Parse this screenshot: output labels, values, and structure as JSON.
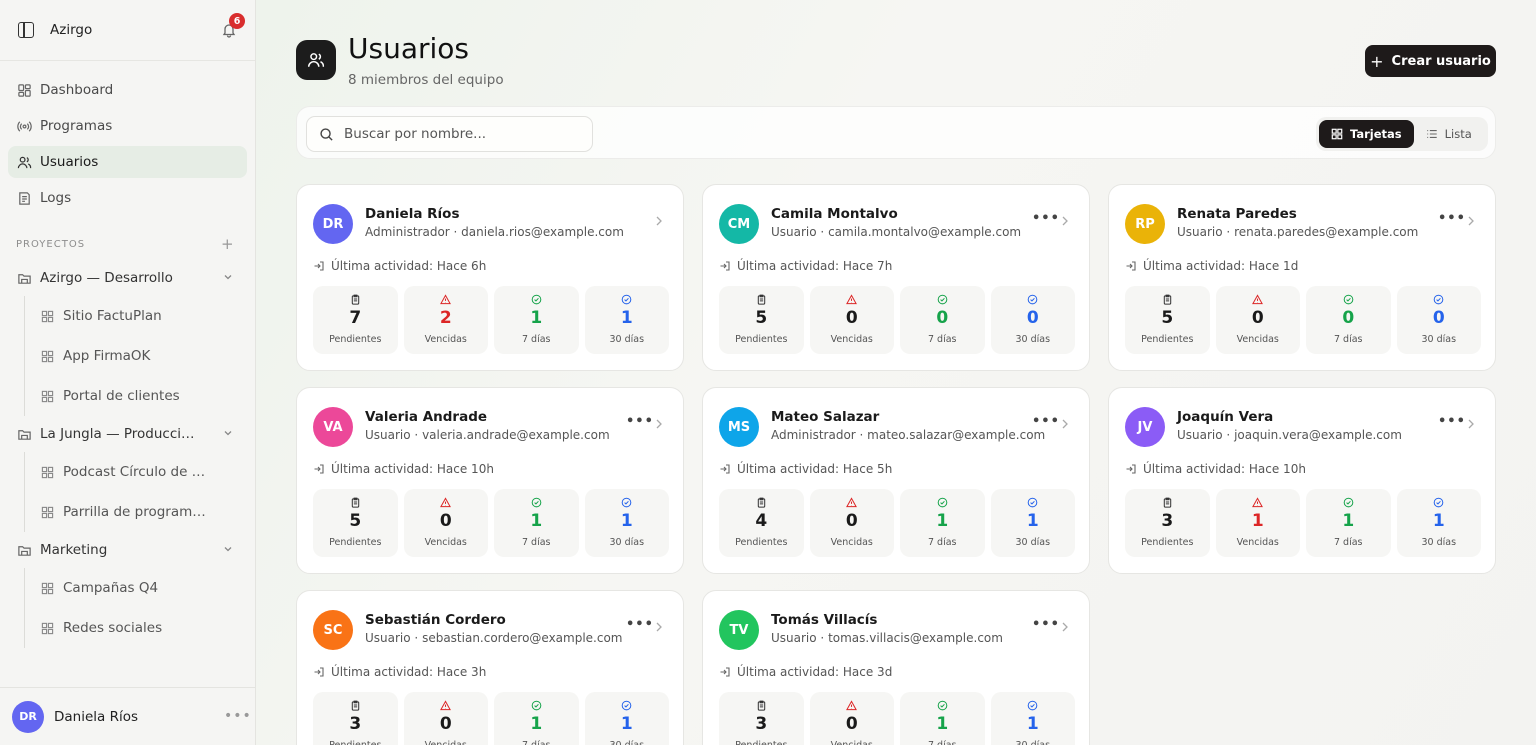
{
  "sidebar": {
    "app_name": "Azirgo",
    "notifications_count": "6",
    "nav": [
      {
        "label": "Dashboard",
        "icon": "dashboard-icon"
      },
      {
        "label": "Programas",
        "icon": "broadcast-icon"
      },
      {
        "label": "Usuarios",
        "icon": "users-icon",
        "active": true
      },
      {
        "label": "Logs",
        "icon": "logs-icon"
      }
    ],
    "projects_label": "PROYECTOS",
    "projects": [
      {
        "label": "Azirgo — Desarrollo",
        "items": [
          "Sitio FactuPlan",
          "App FirmaOK",
          "Portal de clientes"
        ]
      },
      {
        "label": "La Jungla — Producci…",
        "items": [
          "Podcast Círculo de …",
          "Parrilla de program…"
        ]
      },
      {
        "label": "Marketing",
        "items": [
          "Campañas Q4",
          "Redes sociales"
        ]
      }
    ],
    "user": {
      "initials": "DR",
      "name": "Daniela Ríos"
    }
  },
  "header": {
    "title": "Usuarios",
    "subtitle": "8 miembros del equipo",
    "create_label": "Crear usuario"
  },
  "toolbar": {
    "search_placeholder": "Buscar por nombre...",
    "view_cards": "Tarjetas",
    "view_list": "Lista"
  },
  "stat_labels": [
    "Pendientes",
    "Vencidas",
    "7 días",
    "30 días"
  ],
  "colors": {
    "accent": "#1e1a1a",
    "danger": "#dc2626",
    "success": "#16a34a",
    "info": "#2563eb"
  },
  "users": [
    {
      "initials": "DR",
      "name": "Daniela Ríos",
      "role": "Administrador",
      "email": "daniela.rios@example.com",
      "activity": "Última actividad: Hace 6h",
      "color": "#6366f1",
      "stats": [
        "7",
        "2",
        "1",
        "1"
      ],
      "has_menu": false
    },
    {
      "initials": "CM",
      "name": "Camila Montalvo",
      "role": "Usuario",
      "email": "camila.montalvo@example.com",
      "activity": "Última actividad: Hace 7h",
      "color": "#14b8a6",
      "stats": [
        "5",
        "0",
        "0",
        "0"
      ],
      "has_menu": true
    },
    {
      "initials": "RP",
      "name": "Renata Paredes",
      "role": "Usuario",
      "email": "renata.paredes@example.com",
      "activity": "Última actividad: Hace 1d",
      "color": "#eab308",
      "stats": [
        "5",
        "0",
        "0",
        "0"
      ],
      "has_menu": true
    },
    {
      "initials": "VA",
      "name": "Valeria Andrade",
      "role": "Usuario",
      "email": "valeria.andrade@example.com",
      "activity": "Última actividad: Hace 10h",
      "color": "#ec4899",
      "stats": [
        "5",
        "0",
        "1",
        "1"
      ],
      "has_menu": true
    },
    {
      "initials": "MS",
      "name": "Mateo Salazar",
      "role": "Administrador",
      "email": "mateo.salazar@example.com",
      "activity": "Última actividad: Hace 5h",
      "color": "#0ea5e9",
      "stats": [
        "4",
        "0",
        "1",
        "1"
      ],
      "has_menu": true
    },
    {
      "initials": "JV",
      "name": "Joaquín Vera",
      "role": "Usuario",
      "email": "joaquin.vera@example.com",
      "activity": "Última actividad: Hace 10h",
      "color": "#8b5cf6",
      "stats": [
        "3",
        "1",
        "1",
        "1"
      ],
      "has_menu": true
    },
    {
      "initials": "SC",
      "name": "Sebastián Cordero",
      "role": "Usuario",
      "email": "sebastian.cordero@example.com",
      "activity": "Última actividad: Hace 3h",
      "color": "#f97316",
      "stats": [
        "3",
        "0",
        "1",
        "1"
      ],
      "has_menu": true
    },
    {
      "initials": "TV",
      "name": "Tomás Villacís",
      "role": "Usuario",
      "email": "tomas.villacis@example.com",
      "activity": "Última actividad: Hace 3d",
      "color": "#22c55e",
      "stats": [
        "3",
        "0",
        "1",
        "1"
      ],
      "has_menu": true
    }
  ]
}
